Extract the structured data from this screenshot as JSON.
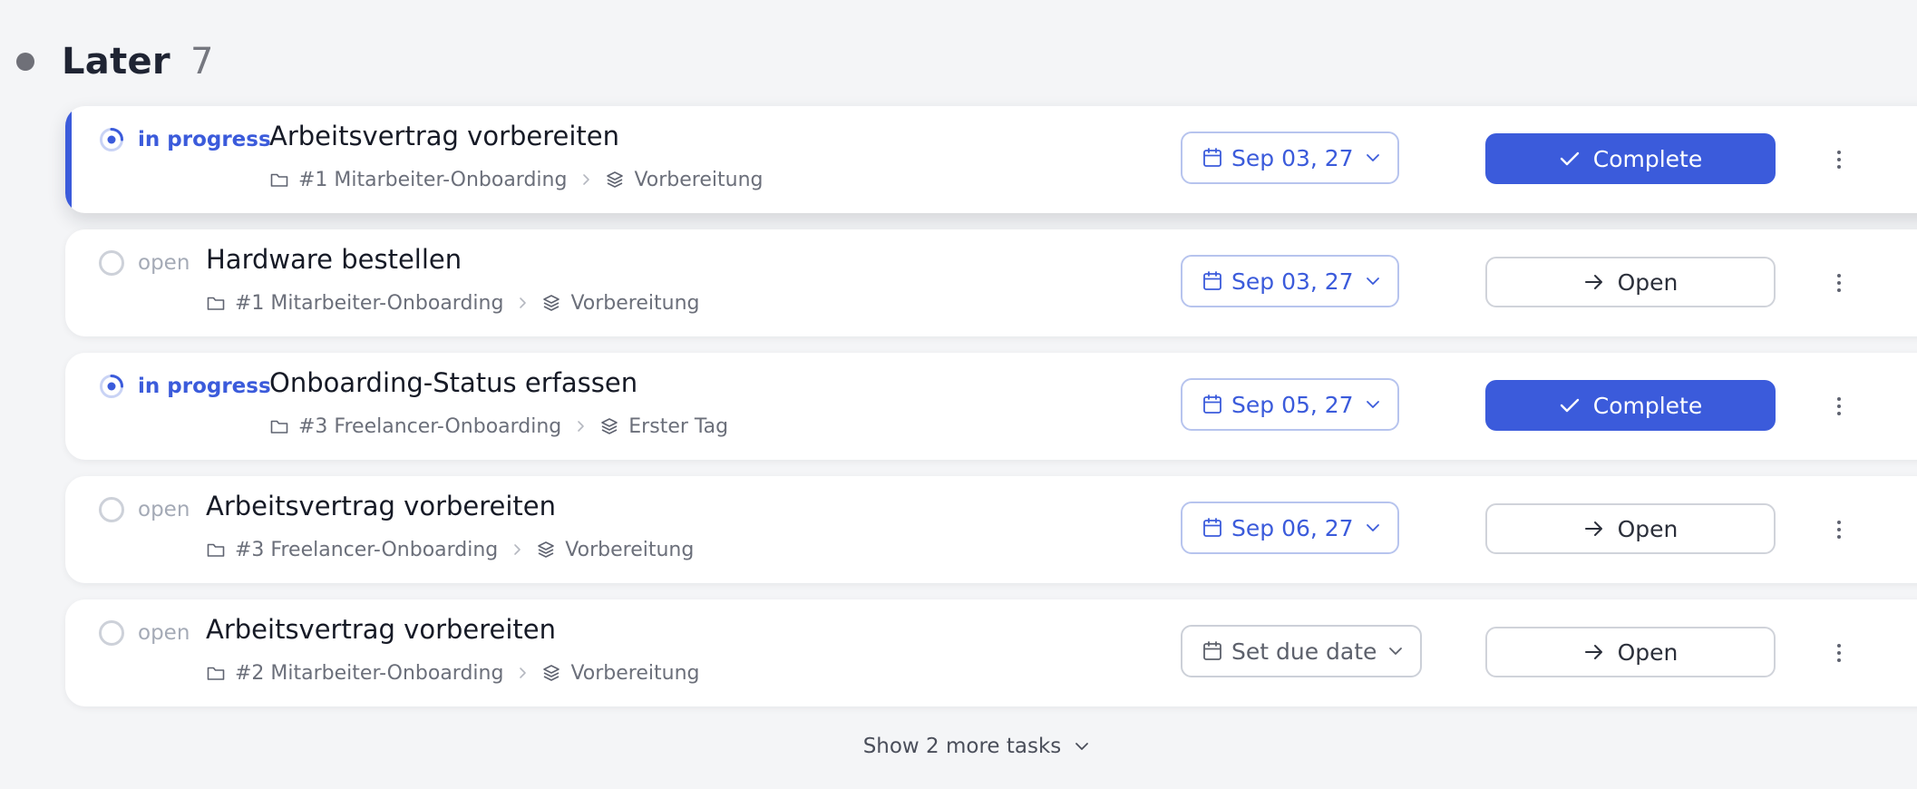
{
  "group": {
    "title": "Later",
    "count": "7"
  },
  "tasks": [
    {
      "status": "in progress",
      "title": "Arbeitsvertrag vorbereiten",
      "project": "#1 Mitarbeiter-Onboarding",
      "phase": "Vorbereitung",
      "due": "Sep 03, 27",
      "action": "Complete"
    },
    {
      "status": "open",
      "title": "Hardware bestellen",
      "project": "#1 Mitarbeiter-Onboarding",
      "phase": "Vorbereitung",
      "due": "Sep 03, 27",
      "action": "Open"
    },
    {
      "status": "in progress",
      "title": "Onboarding-Status erfassen",
      "project": "#3 Freelancer-Onboarding",
      "phase": "Erster Tag",
      "due": "Sep 05, 27",
      "action": "Complete"
    },
    {
      "status": "open",
      "title": "Arbeitsvertrag vorbereiten",
      "project": "#3 Freelancer-Onboarding",
      "phase": "Vorbereitung",
      "due": "Sep 06, 27",
      "action": "Open"
    },
    {
      "status": "open",
      "title": "Arbeitsvertrag vorbereiten",
      "project": "#2 Mitarbeiter-Onboarding",
      "phase": "Vorbereitung",
      "due": "Set due date",
      "action": "Open"
    }
  ],
  "show_more": "Show 2 more tasks",
  "colors": {
    "accent": "#3b5bdb",
    "background": "#f4f5f7",
    "card": "#ffffff",
    "open_status": "#a4aab6"
  },
  "icons": {
    "status_in_progress": "in-progress-circle-icon",
    "status_open": "empty-circle-icon",
    "project": "folder-icon",
    "separator": "chevron-right-icon",
    "phase": "layers-icon",
    "due": "calendar-icon",
    "due_toggle": "chevron-down-icon",
    "complete": "check-icon",
    "open": "arrow-right-icon",
    "menu": "kebab-menu-icon"
  }
}
